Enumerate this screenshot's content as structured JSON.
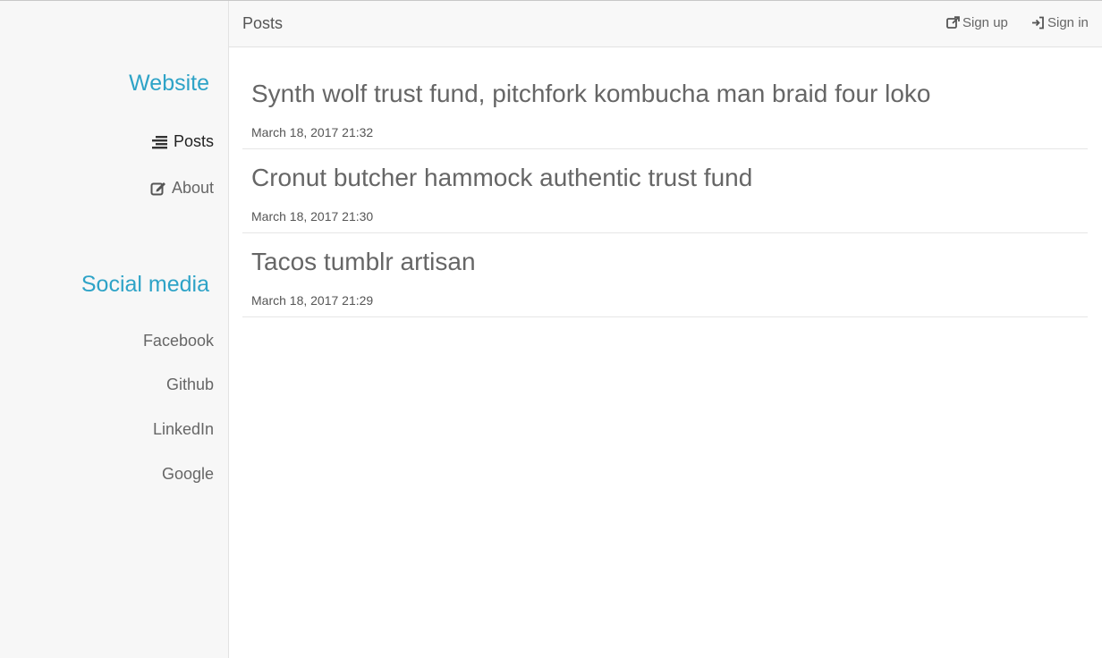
{
  "sidebar": {
    "website_heading": "Website",
    "nav": [
      {
        "label": "Posts",
        "icon": "list-icon",
        "active": true
      },
      {
        "label": "About",
        "icon": "edit-icon",
        "active": false
      }
    ],
    "social_heading": "Social media",
    "social": [
      {
        "label": "Facebook"
      },
      {
        "label": "Github"
      },
      {
        "label": "LinkedIn"
      },
      {
        "label": "Google"
      }
    ]
  },
  "topbar": {
    "title": "Posts",
    "signup_label": "Sign up",
    "signup_icon": "external-link-icon",
    "signin_label": "Sign in",
    "signin_icon": "sign-in-icon"
  },
  "posts": [
    {
      "title": "Synth wolf trust fund, pitchfork kombucha man braid four loko",
      "date": "March 18, 2017 21:32"
    },
    {
      "title": "Cronut butcher hammock authentic trust fund",
      "date": "March 18, 2017 21:30"
    },
    {
      "title": "Tacos tumblr artisan",
      "date": "March 18, 2017 21:29"
    }
  ],
  "colors": {
    "accent": "#2ea3c7",
    "sidebar_bg": "#f7f7f7",
    "text": "#666666"
  }
}
